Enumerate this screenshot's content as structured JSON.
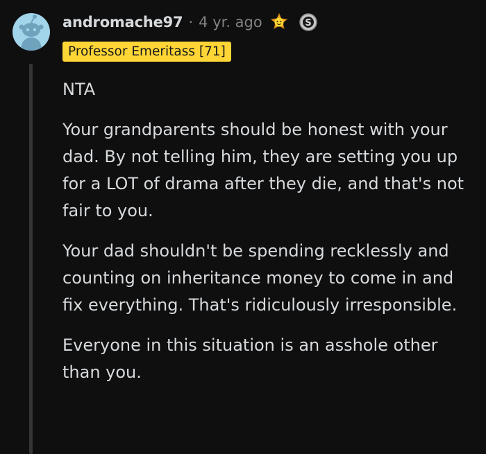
{
  "comment": {
    "author": "andromache97",
    "separator": "·",
    "timestamp": "4 yr. ago",
    "awards": [
      "wholesome-award-icon",
      "silver-award-icon"
    ],
    "flair": "Professor Emeritass [71]",
    "paragraphs": [
      "NTA",
      "Your grandparents should be honest with your dad. By not telling him, they are setting you up for a LOT of drama after they die, and that's not fair to you.",
      "Your dad shouldn't be spending recklessly and counting on inheritance money to come in and fix everything. That's ridiculously irresponsible.",
      "Everyone in this situation is an asshole other than you."
    ]
  },
  "colors": {
    "background": "#0f0f10",
    "text": "#d7dadc",
    "muted": "#818384",
    "flair_bg": "#ffd635",
    "avatar_bg": "#a3d5ea",
    "thread_line": "#343536"
  }
}
